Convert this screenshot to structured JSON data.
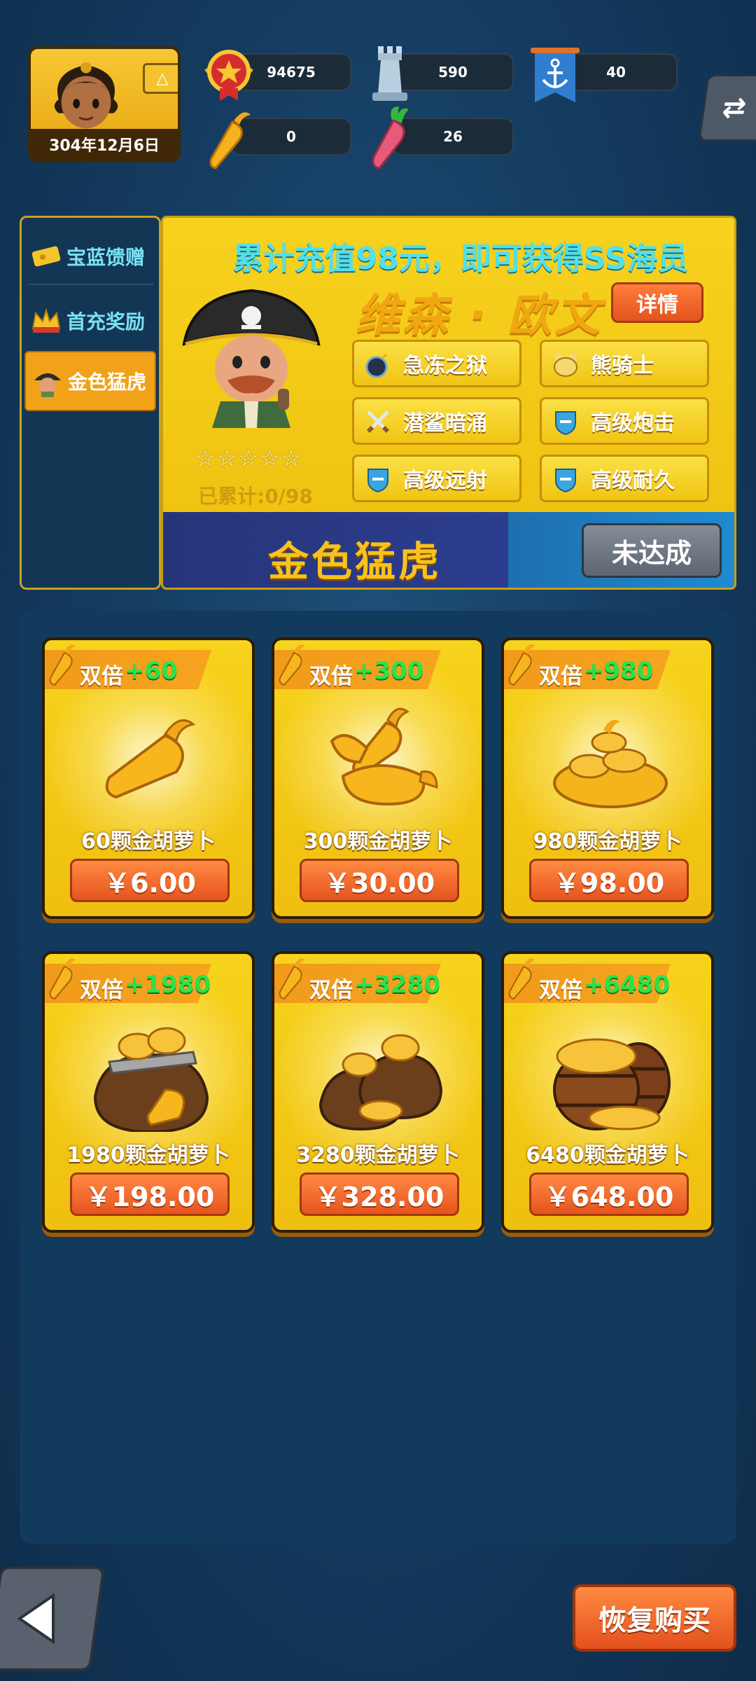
{
  "player": {
    "date": "304年12月6日",
    "stats": [
      {
        "icon": "medal-icon",
        "value": "94675"
      },
      {
        "icon": "tower-icon",
        "value": "590"
      },
      {
        "icon": "anchor-flag-icon",
        "value": "40"
      },
      {
        "icon": "gold-carrot-icon",
        "value": "0"
      },
      {
        "icon": "red-carrot-icon",
        "value": "26"
      }
    ]
  },
  "sidebar": {
    "items": [
      {
        "label": "宝蓝馈赠",
        "icon": "ticket-icon",
        "active": false
      },
      {
        "label": "首充奖励",
        "icon": "crown-icon",
        "active": false
      },
      {
        "label": "金色猛虎",
        "icon": "pirate-icon",
        "active": true
      }
    ]
  },
  "promo": {
    "headline": "累计充值98元，即可获得SS海员",
    "hero_name": "维森 · 欧文",
    "detail_label": "详情",
    "stars": "☆☆☆☆☆",
    "progress": "已累计:0/98",
    "skills": [
      {
        "label": "急冻之狱",
        "icon": "bomb-icon"
      },
      {
        "label": "熊骑士",
        "icon": "bear-icon"
      },
      {
        "label": "潜鲨暗涌",
        "icon": "swords-icon"
      },
      {
        "label": "高级炮击",
        "icon": "shield-icon"
      },
      {
        "label": "高级远射",
        "icon": "shield-icon"
      },
      {
        "label": "高级耐久",
        "icon": "shield-icon"
      }
    ],
    "banner_title": "金色猛虎",
    "status_label": "未达成"
  },
  "shop": {
    "items": [
      {
        "tag": "双倍",
        "bonus": "+60",
        "name": "60颗金胡萝卜",
        "price": "￥6.00"
      },
      {
        "tag": "双倍",
        "bonus": "+300",
        "name": "300颗金胡萝卜",
        "price": "￥30.00"
      },
      {
        "tag": "双倍",
        "bonus": "+980",
        "name": "980颗金胡萝卜",
        "price": "￥98.00"
      },
      {
        "tag": "双倍",
        "bonus": "+1980",
        "name": "1980颗金胡萝卜",
        "price": "￥198.00"
      },
      {
        "tag": "双倍",
        "bonus": "+3280",
        "name": "3280颗金胡萝卜",
        "price": "￥328.00"
      },
      {
        "tag": "双倍",
        "bonus": "+6480",
        "name": "6480颗金胡萝卜",
        "price": "￥648.00"
      }
    ]
  },
  "footer": {
    "restore_label": "恢复购买"
  },
  "colors": {
    "background": "#143a5e",
    "gold": "#f2c316",
    "orange_button": "#ee6a2c",
    "cyan_text": "#52e0ea",
    "bonus_green": "#2fe04a"
  }
}
